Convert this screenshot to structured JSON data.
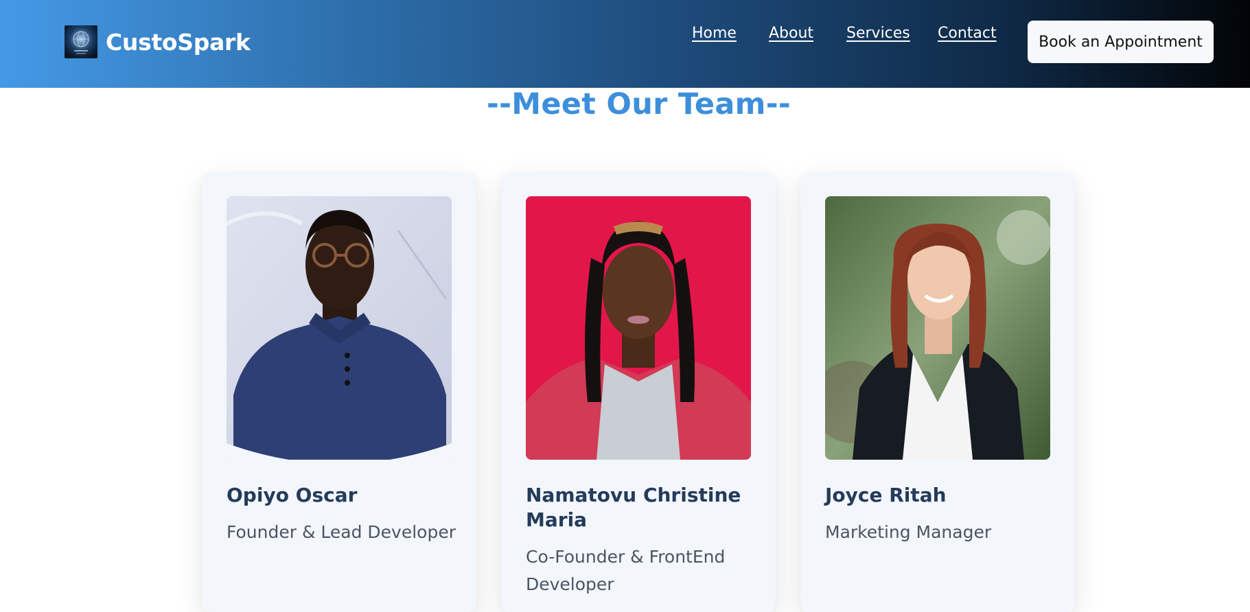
{
  "brand": {
    "name": "CustoSpark",
    "logo_icon": "globe-logo-icon"
  },
  "nav": {
    "items": [
      {
        "label": "Home"
      },
      {
        "label": "About"
      },
      {
        "label": "Services"
      },
      {
        "label": "Contact"
      }
    ],
    "cta_label": "Book an Appointment"
  },
  "team": {
    "title": "--Meet Our Team--",
    "members": [
      {
        "name": "Opiyo Oscar",
        "role": "Founder & Lead Developer",
        "photo_icon": "portrait-photo"
      },
      {
        "name": "Namatovu Christine Maria",
        "role": "Co-Founder & FrontEnd Developer",
        "photo_icon": "portrait-photo"
      },
      {
        "name": "Joyce Ritah",
        "role": "Marketing Manager",
        "photo_icon": "portrait-photo"
      }
    ]
  },
  "colors": {
    "header_start": "#4499e6",
    "header_end": "#020406",
    "title_accent": "#3d8fdb",
    "name_color": "#243b5a",
    "card_bg": "#f3f6fa"
  }
}
